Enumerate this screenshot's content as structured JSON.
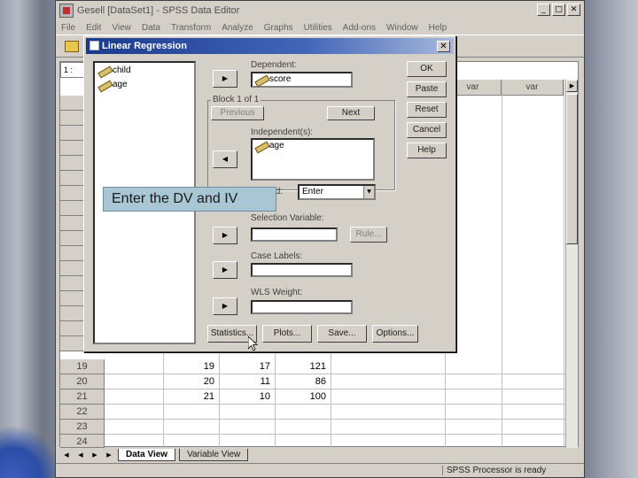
{
  "window": {
    "title": "Gesell [DataSet1] - SPSS Data Editor",
    "minimize": "_",
    "maximize": "□",
    "close": "✕"
  },
  "menu": [
    "File",
    "Edit",
    "View",
    "Data",
    "Transform",
    "Analyze",
    "Graphs",
    "Utilities",
    "Add-ons",
    "Window",
    "Help"
  ],
  "grid": {
    "cell_ref": "1 : ",
    "var_headers": [
      "var",
      "var"
    ],
    "rows": [
      {
        "n": "19",
        "c1": "19",
        "c2": "17",
        "c3": "121"
      },
      {
        "n": "20",
        "c1": "20",
        "c2": "11",
        "c3": "86"
      },
      {
        "n": "21",
        "c1": "21",
        "c2": "10",
        "c3": "100"
      },
      {
        "n": "22"
      },
      {
        "n": "23"
      },
      {
        "n": "24"
      }
    ]
  },
  "tabs": {
    "data_view": "Data View",
    "variable_view": "Variable View"
  },
  "status": "SPSS Processor is ready",
  "dialog": {
    "title": "Linear Regression",
    "variables": [
      "child",
      "age"
    ],
    "dependent_label": "Dependent:",
    "dependent_value": "score",
    "block_label": "Block 1 of 1",
    "previous": "Previous",
    "next": "Next",
    "independent_label": "Independent(s):",
    "independent_values": [
      "age"
    ],
    "method_label": "Method:",
    "method_value": "Enter",
    "selection_label": "Selection Variable:",
    "rule_button": "Rule...",
    "case_labels_label": "Case Labels:",
    "wls_label": "WLS Weight:",
    "buttons": {
      "ok": "OK",
      "paste": "Paste",
      "reset": "Reset",
      "cancel": "Cancel",
      "help": "Help"
    },
    "bottom_buttons": {
      "statistics": "Statistics...",
      "plots": "Plots...",
      "save": "Save...",
      "options": "Options..."
    }
  },
  "callout": "Enter the DV and IV",
  "icons": {
    "move_right": "▶",
    "move_left": "◀",
    "dropdown": "▼"
  }
}
